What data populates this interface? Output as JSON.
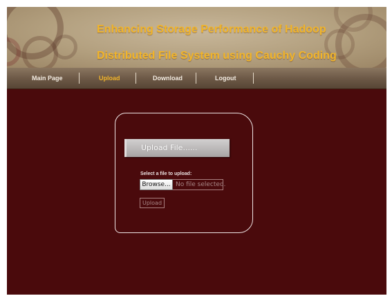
{
  "header": {
    "title_line1": "Enhancing Storage Performance of Hadoop",
    "title_line2": "Distributed File System using Cauchy Coding"
  },
  "nav": {
    "items": [
      {
        "label": "Main Page",
        "active": false
      },
      {
        "label": "Upload",
        "active": true
      },
      {
        "label": "Download",
        "active": false
      },
      {
        "label": "Logout",
        "active": false
      }
    ]
  },
  "upload_panel": {
    "heading": "Upload File......",
    "file_label": "Select a file to upload:",
    "browse_label": "Browse...",
    "file_status": "No file selected.",
    "upload_label": "Upload"
  },
  "colors": {
    "background": "#4a0a0c",
    "title": "#f2b52a",
    "active_nav": "#f2b52a",
    "nav_text": "#f3ece2"
  }
}
